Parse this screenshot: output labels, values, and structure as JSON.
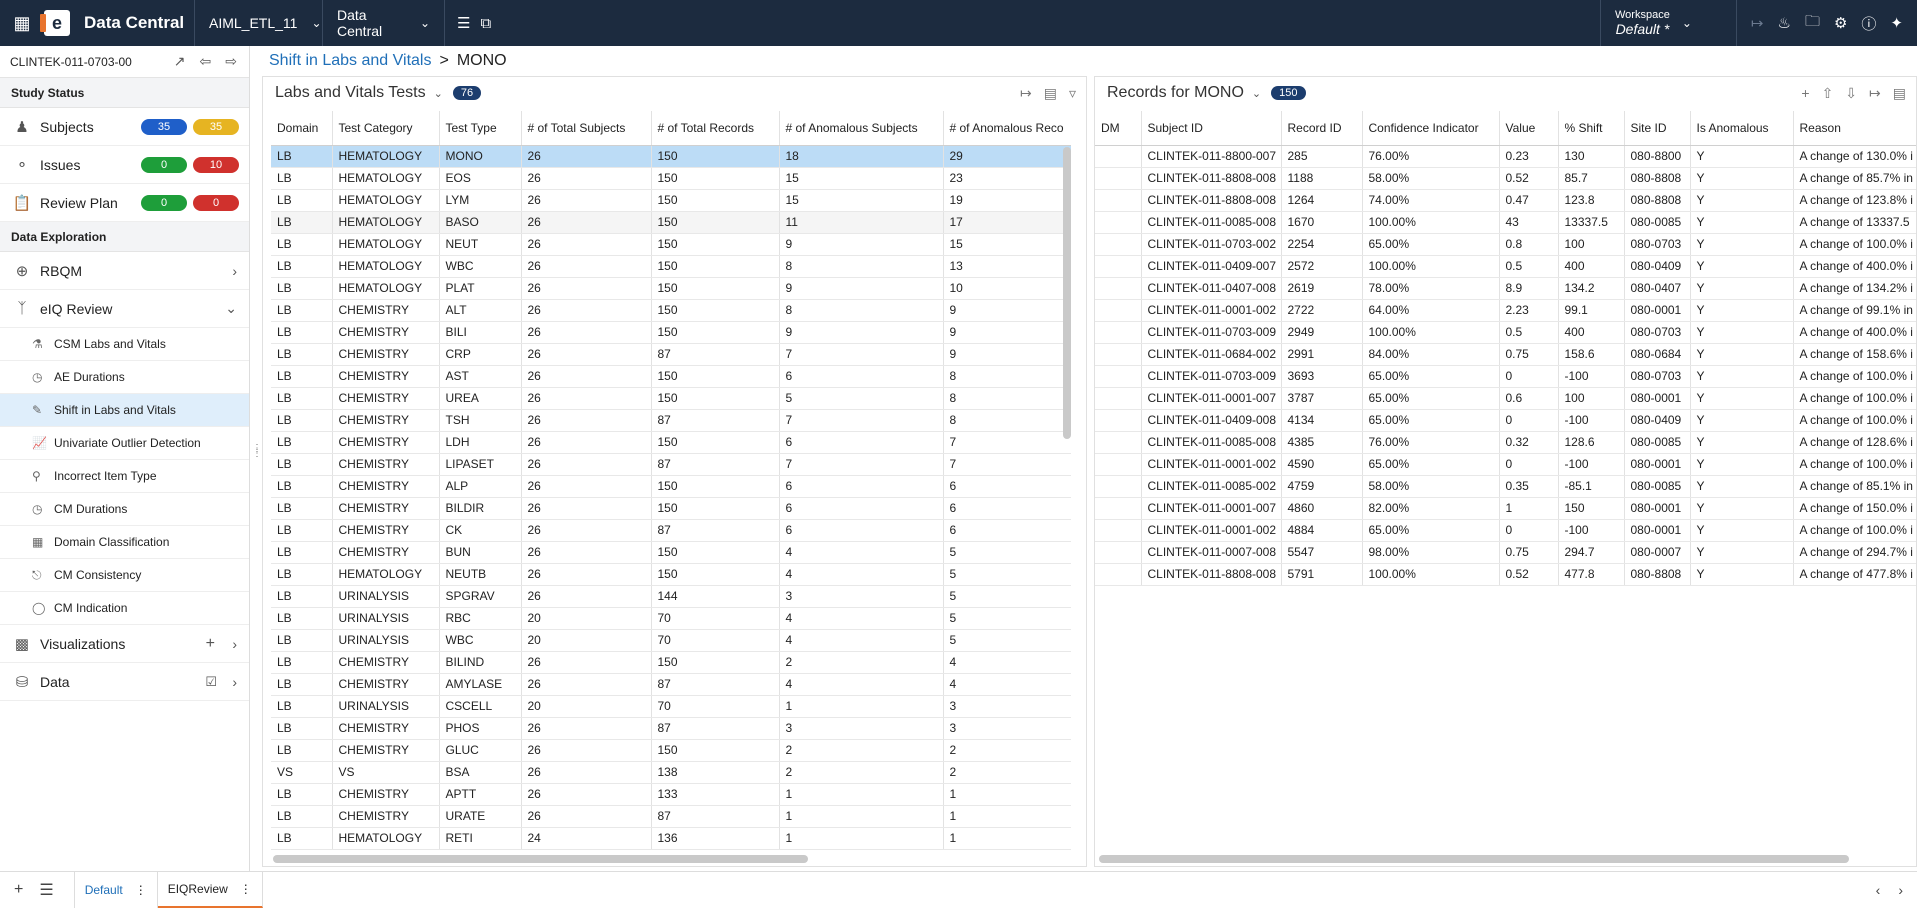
{
  "topbar": {
    "app_title": "Data Central",
    "dataset": "AIML_ETL_11",
    "module": "Data Central",
    "workspace_label": "Workspace",
    "workspace_value": "Default",
    "workspace_modified": "*"
  },
  "sidebar": {
    "study_id": "CLINTEK-011-0703-00",
    "study_status": "Study Status",
    "subjects": {
      "label": "Subjects",
      "b1": "35",
      "b2": "35"
    },
    "issues": {
      "label": "Issues",
      "b1": "0",
      "b2": "10"
    },
    "review_plan": {
      "label": "Review Plan",
      "b1": "0",
      "b2": "0"
    },
    "data_exploration": "Data Exploration",
    "rbqm": "RBQM",
    "eiq_review": "eIQ Review",
    "sub_items": [
      "CSM Labs and Vitals",
      "AE Durations",
      "Shift in Labs and Vitals",
      "Univariate Outlier Detection",
      "Incorrect Item Type",
      "CM Durations",
      "Domain Classification",
      "CM Consistency",
      "CM Indication"
    ],
    "visualizations": "Visualizations",
    "data": "Data"
  },
  "breadcrumb": {
    "parent": "Shift in Labs and Vitals",
    "sep": ">",
    "current": "MONO"
  },
  "left_panel": {
    "title": "Labs and Vitals Tests",
    "count": "76",
    "columns": [
      "Domain",
      "Test Category",
      "Test Type",
      "# of Total Subjects",
      "# of Total Records",
      "# of Anomalous Subjects",
      "# of Anomalous Reco"
    ],
    "rows": [
      [
        "LB",
        "HEMATOLOGY",
        "MONO",
        "26",
        "150",
        "18",
        "29"
      ],
      [
        "LB",
        "HEMATOLOGY",
        "EOS",
        "26",
        "150",
        "15",
        "23"
      ],
      [
        "LB",
        "HEMATOLOGY",
        "LYM",
        "26",
        "150",
        "15",
        "19"
      ],
      [
        "LB",
        "HEMATOLOGY",
        "BASO",
        "26",
        "150",
        "11",
        "17"
      ],
      [
        "LB",
        "HEMATOLOGY",
        "NEUT",
        "26",
        "150",
        "9",
        "15"
      ],
      [
        "LB",
        "HEMATOLOGY",
        "WBC",
        "26",
        "150",
        "8",
        "13"
      ],
      [
        "LB",
        "HEMATOLOGY",
        "PLAT",
        "26",
        "150",
        "9",
        "10"
      ],
      [
        "LB",
        "CHEMISTRY",
        "ALT",
        "26",
        "150",
        "8",
        "9"
      ],
      [
        "LB",
        "CHEMISTRY",
        "BILI",
        "26",
        "150",
        "9",
        "9"
      ],
      [
        "LB",
        "CHEMISTRY",
        "CRP",
        "26",
        "87",
        "7",
        "9"
      ],
      [
        "LB",
        "CHEMISTRY",
        "AST",
        "26",
        "150",
        "6",
        "8"
      ],
      [
        "LB",
        "CHEMISTRY",
        "UREA",
        "26",
        "150",
        "5",
        "8"
      ],
      [
        "LB",
        "CHEMISTRY",
        "TSH",
        "26",
        "87",
        "7",
        "8"
      ],
      [
        "LB",
        "CHEMISTRY",
        "LDH",
        "26",
        "150",
        "6",
        "7"
      ],
      [
        "LB",
        "CHEMISTRY",
        "LIPASET",
        "26",
        "87",
        "7",
        "7"
      ],
      [
        "LB",
        "CHEMISTRY",
        "ALP",
        "26",
        "150",
        "6",
        "6"
      ],
      [
        "LB",
        "CHEMISTRY",
        "BILDIR",
        "26",
        "150",
        "6",
        "6"
      ],
      [
        "LB",
        "CHEMISTRY",
        "CK",
        "26",
        "87",
        "6",
        "6"
      ],
      [
        "LB",
        "CHEMISTRY",
        "BUN",
        "26",
        "150",
        "4",
        "5"
      ],
      [
        "LB",
        "HEMATOLOGY",
        "NEUTB",
        "26",
        "150",
        "4",
        "5"
      ],
      [
        "LB",
        "URINALYSIS",
        "SPGRAV",
        "26",
        "144",
        "3",
        "5"
      ],
      [
        "LB",
        "URINALYSIS",
        "RBC",
        "20",
        "70",
        "4",
        "5"
      ],
      [
        "LB",
        "URINALYSIS",
        "WBC",
        "20",
        "70",
        "4",
        "5"
      ],
      [
        "LB",
        "CHEMISTRY",
        "BILIND",
        "26",
        "150",
        "2",
        "4"
      ],
      [
        "LB",
        "CHEMISTRY",
        "AMYLASE",
        "26",
        "87",
        "4",
        "4"
      ],
      [
        "LB",
        "URINALYSIS",
        "CSCELL",
        "20",
        "70",
        "1",
        "3"
      ],
      [
        "LB",
        "CHEMISTRY",
        "PHOS",
        "26",
        "87",
        "3",
        "3"
      ],
      [
        "LB",
        "CHEMISTRY",
        "GLUC",
        "26",
        "150",
        "2",
        "2"
      ],
      [
        "VS",
        "VS",
        "BSA",
        "26",
        "138",
        "2",
        "2"
      ],
      [
        "LB",
        "CHEMISTRY",
        "APTT",
        "26",
        "133",
        "1",
        "1"
      ],
      [
        "LB",
        "CHEMISTRY",
        "URATE",
        "26",
        "87",
        "1",
        "1"
      ],
      [
        "LB",
        "HEMATOLOGY",
        "RETI",
        "24",
        "136",
        "1",
        "1"
      ]
    ]
  },
  "right_panel": {
    "title": "Records for MONO",
    "count": "150",
    "columns": [
      "DM",
      "Subject ID",
      "Record ID",
      "Confidence Indicator",
      "Value",
      "% Shift",
      "Site ID",
      "Is Anomalous",
      "Reason"
    ],
    "rows": [
      [
        "",
        "CLINTEK-011-8800-007",
        "285",
        "76.00%",
        "0.23",
        "130",
        "080-8800",
        "Y",
        "A change of 130.0% i"
      ],
      [
        "",
        "CLINTEK-011-8808-008",
        "1188",
        "58.00%",
        "0.52",
        "85.7",
        "080-8808",
        "Y",
        "A change of 85.7% in"
      ],
      [
        "",
        "CLINTEK-011-8808-008",
        "1264",
        "74.00%",
        "0.47",
        "123.8",
        "080-8808",
        "Y",
        "A change of 123.8% i"
      ],
      [
        "",
        "CLINTEK-011-0085-008",
        "1670",
        "100.00%",
        "43",
        "13337.5",
        "080-0085",
        "Y",
        "A change of 13337.5"
      ],
      [
        "",
        "CLINTEK-011-0703-002",
        "2254",
        "65.00%",
        "0.8",
        "100",
        "080-0703",
        "Y",
        "A change of 100.0% i"
      ],
      [
        "",
        "CLINTEK-011-0409-007",
        "2572",
        "100.00%",
        "0.5",
        "400",
        "080-0409",
        "Y",
        "A change of 400.0% i"
      ],
      [
        "",
        "CLINTEK-011-0407-008",
        "2619",
        "78.00%",
        "8.9",
        "134.2",
        "080-0407",
        "Y",
        "A change of 134.2% i"
      ],
      [
        "",
        "CLINTEK-011-0001-002",
        "2722",
        "64.00%",
        "2.23",
        "99.1",
        "080-0001",
        "Y",
        "A change of 99.1% in"
      ],
      [
        "",
        "CLINTEK-011-0703-009",
        "2949",
        "100.00%",
        "0.5",
        "400",
        "080-0703",
        "Y",
        "A change of 400.0% i"
      ],
      [
        "",
        "CLINTEK-011-0684-002",
        "2991",
        "84.00%",
        "0.75",
        "158.6",
        "080-0684",
        "Y",
        "A change of 158.6% i"
      ],
      [
        "",
        "CLINTEK-011-0703-009",
        "3693",
        "65.00%",
        "0",
        "-100",
        "080-0703",
        "Y",
        "A change of 100.0% i"
      ],
      [
        "",
        "CLINTEK-011-0001-007",
        "3787",
        "65.00%",
        "0.6",
        "100",
        "080-0001",
        "Y",
        "A change of 100.0% i"
      ],
      [
        "",
        "CLINTEK-011-0409-008",
        "4134",
        "65.00%",
        "0",
        "-100",
        "080-0409",
        "Y",
        "A change of 100.0% i"
      ],
      [
        "",
        "CLINTEK-011-0085-008",
        "4385",
        "76.00%",
        "0.32",
        "128.6",
        "080-0085",
        "Y",
        "A change of 128.6% i"
      ],
      [
        "",
        "CLINTEK-011-0001-002",
        "4590",
        "65.00%",
        "0",
        "-100",
        "080-0001",
        "Y",
        "A change of 100.0% i"
      ],
      [
        "",
        "CLINTEK-011-0085-002",
        "4759",
        "58.00%",
        "0.35",
        "-85.1",
        "080-0085",
        "Y",
        "A change of 85.1% in"
      ],
      [
        "",
        "CLINTEK-011-0001-007",
        "4860",
        "82.00%",
        "1",
        "150",
        "080-0001",
        "Y",
        "A change of 150.0% i"
      ],
      [
        "",
        "CLINTEK-011-0001-002",
        "4884",
        "65.00%",
        "0",
        "-100",
        "080-0001",
        "Y",
        "A change of 100.0% i"
      ],
      [
        "",
        "CLINTEK-011-0007-008",
        "5547",
        "98.00%",
        "0.75",
        "294.7",
        "080-0007",
        "Y",
        "A change of 294.7% i"
      ],
      [
        "",
        "CLINTEK-011-8808-008",
        "5791",
        "100.00%",
        "0.52",
        "477.8",
        "080-8808",
        "Y",
        "A change of 477.8% i"
      ]
    ]
  },
  "bottom_tabs": [
    "Default",
    "EIQReview"
  ],
  "colors": {
    "topbar": "#1c2b3f",
    "accent": "#1f6fb8",
    "badge_blue": "#1f5fc9",
    "badge_yellow": "#e6b422",
    "badge_green": "#1e9e3a",
    "badge_red": "#d0312d",
    "selected_row": "#bcdcf6"
  }
}
